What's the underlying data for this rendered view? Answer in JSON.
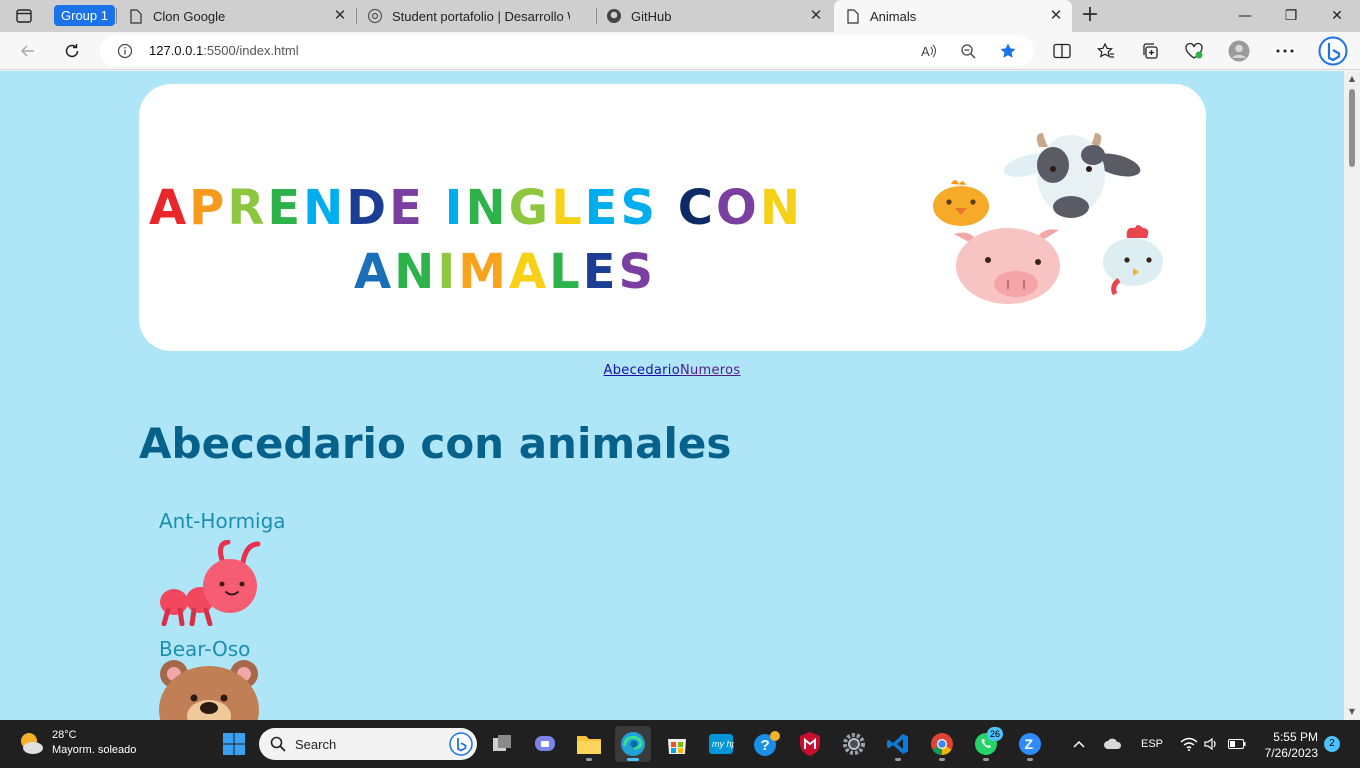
{
  "browser": {
    "group_chip": "Group 1",
    "tabs": [
      {
        "title": "Clon Google"
      },
      {
        "title": "Student portafolio | Desarrollo W"
      },
      {
        "title": "GitHub"
      },
      {
        "title": "Animals"
      }
    ],
    "url_host": "127.0.0.1",
    "url_rest": ":5500/index.html"
  },
  "page": {
    "banner": {
      "line1_words": [
        {
          "text": "APRENDE",
          "colors": [
            "#e8262b",
            "#f89a1c",
            "#8dc63f",
            "#2db34a",
            "#00aeef",
            "#1b3e94",
            "#7a3fa0"
          ]
        },
        {
          "text": "INGLES",
          "colors": [
            "#00aeef",
            "#2db34a",
            "#8dc63f",
            "#f7d117",
            "#00aeef",
            "#00aeef"
          ]
        },
        {
          "text": "CON",
          "colors": [
            "#0e2a66",
            "#7a3fa0",
            "#f7d117"
          ]
        }
      ],
      "line2": {
        "text": "ANIMALES",
        "colors": [
          "#1b6fb8",
          "#2db34a",
          "#8dc63f",
          "#f7a31c",
          "#f7d117",
          "#2db34a",
          "#1b3e94",
          "#7a3fa0"
        ]
      }
    },
    "nav": {
      "abecedario": "Abecedario",
      "numeros": "Numeros"
    },
    "heading": "Abecedario con animales",
    "animals": [
      {
        "label": "Ant-Hormiga",
        "icon": "ant-icon"
      },
      {
        "label": "Bear-Oso",
        "icon": "bear-icon"
      }
    ]
  },
  "taskbar": {
    "weather_temp": "28°C",
    "weather_desc": "Mayorm. soleado",
    "search_placeholder": "Search",
    "whatsapp_badge": "26",
    "language": "ESP",
    "time": "5:55 PM",
    "date": "7/26/2023",
    "notifications": "2"
  },
  "colors": {
    "page_bg": "#aee6f8",
    "heading": "#06628a",
    "label": "#1c8fb0",
    "accent": "#1a73e8"
  }
}
